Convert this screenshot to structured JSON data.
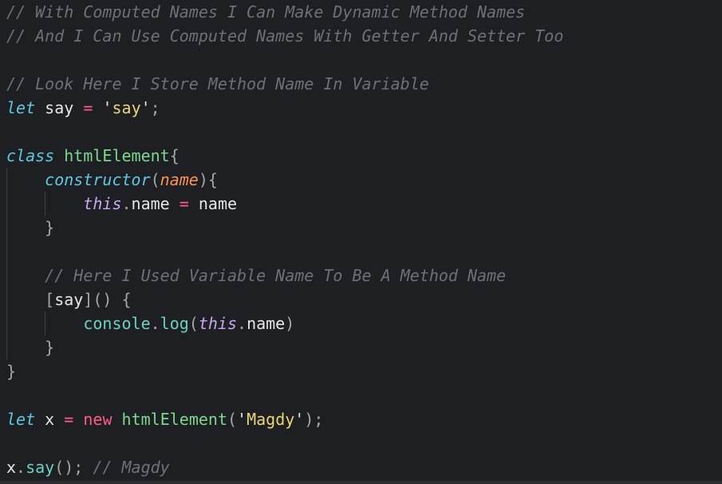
{
  "code": {
    "l1": "// With Computed Names I Can Make Dynamic Method Names",
    "l2": "// And I Can Use Computed Names With Getter And Setter Too",
    "l3": "// Look Here I Store Method Name In Variable",
    "l4": {
      "kw": "let",
      "name": "say",
      "op": "=",
      "q1": "'",
      "str": "say",
      "q2": "'",
      "end": ";"
    },
    "l5": {
      "kw": "class",
      "name": "htmlElement",
      "brace": "{"
    },
    "l6": {
      "name": "constructor",
      "po": "(",
      "param": "name",
      "pc": ")",
      "brace": "{"
    },
    "l7": {
      "this": "this",
      "dot": ".",
      "prop": "name",
      "op": "=",
      "val": "name"
    },
    "l8": "}",
    "l9": "// Here I Used Variable Name To Be A Method Name",
    "l10": {
      "bo": "[",
      "name": "say",
      "bc": "]",
      "parens": "()",
      "brace": "{"
    },
    "l11": {
      "obj": "console",
      "dot": ".",
      "fn": "log",
      "po": "(",
      "this": "this",
      "dot2": ".",
      "prop": "name",
      "pc": ")"
    },
    "l12": "}",
    "l13": "}",
    "l14": {
      "kw": "let",
      "name": "x",
      "op": "=",
      "new": "new",
      "cls": "htmlElement",
      "po": "(",
      "q1": "'",
      "str": "Magdy",
      "q2": "'",
      "pc": ")",
      "end": ";"
    },
    "l15": {
      "obj": "x",
      "dot": ".",
      "fn": "say",
      "call": "();",
      "comment": "// Magdy"
    }
  }
}
